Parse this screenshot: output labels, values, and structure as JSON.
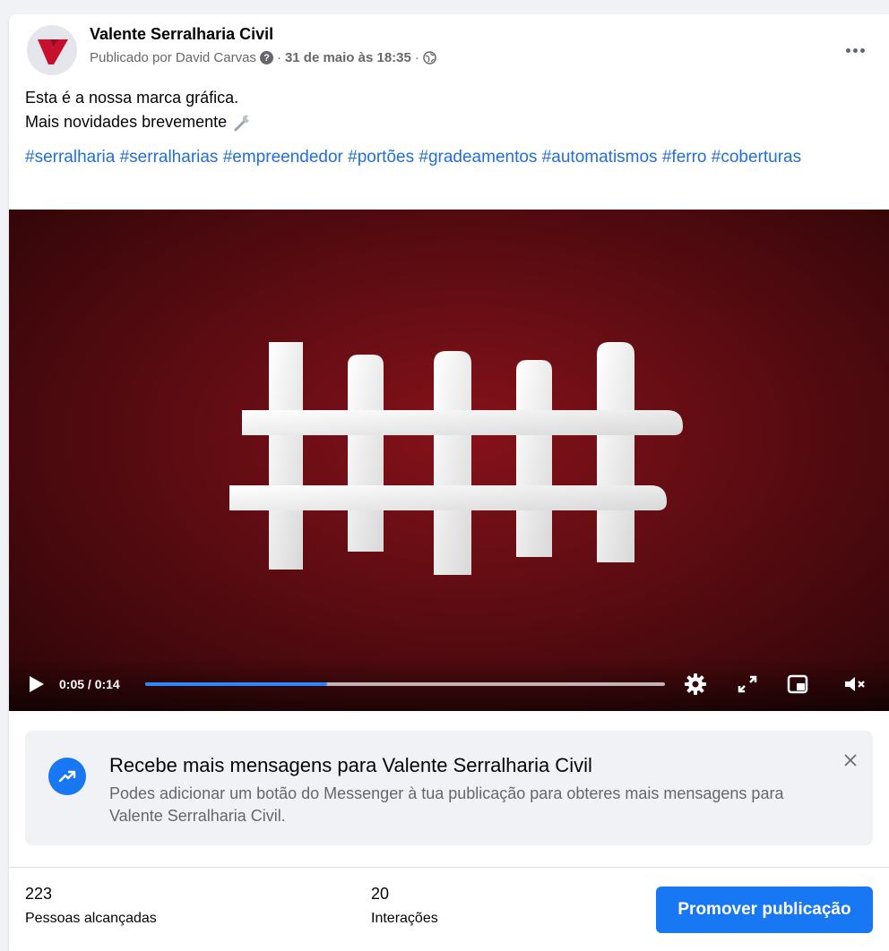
{
  "post": {
    "page_name": "Valente Serralharia Civil",
    "published_by": "Publicado por David Carvas",
    "separator": "·",
    "date": "31 de maio às 18:35",
    "text_line1": "Esta é a nossa marca gráfica.",
    "text_line2": "Mais novidades brevemente",
    "hashtags": [
      "#serralharia",
      "#serralharias",
      "#empreendedor",
      "#portões",
      "#gradeamentos",
      "#automatismos",
      "#ferro",
      "#coberturas"
    ]
  },
  "video": {
    "time": "0:05 / 0:14",
    "progress_fraction": 0.35
  },
  "banner": {
    "title": "Recebe mais mensagens para Valente Serralharia Civil",
    "description": "Podes adicionar um botão do Messenger à tua publicação para obteres mais mensagens para Valente Serralharia Civil."
  },
  "stats": {
    "reach_value": "223",
    "reach_label": "Pessoas alcançadas",
    "interactions_value": "20",
    "interactions_label": "Interações"
  },
  "actions": {
    "promote_label": "Promover publicação"
  },
  "colors": {
    "accent": "#1877f2",
    "hashtag": "#216fdb",
    "logo_red": "#c8102e",
    "video_bg": "#5c0c12"
  }
}
